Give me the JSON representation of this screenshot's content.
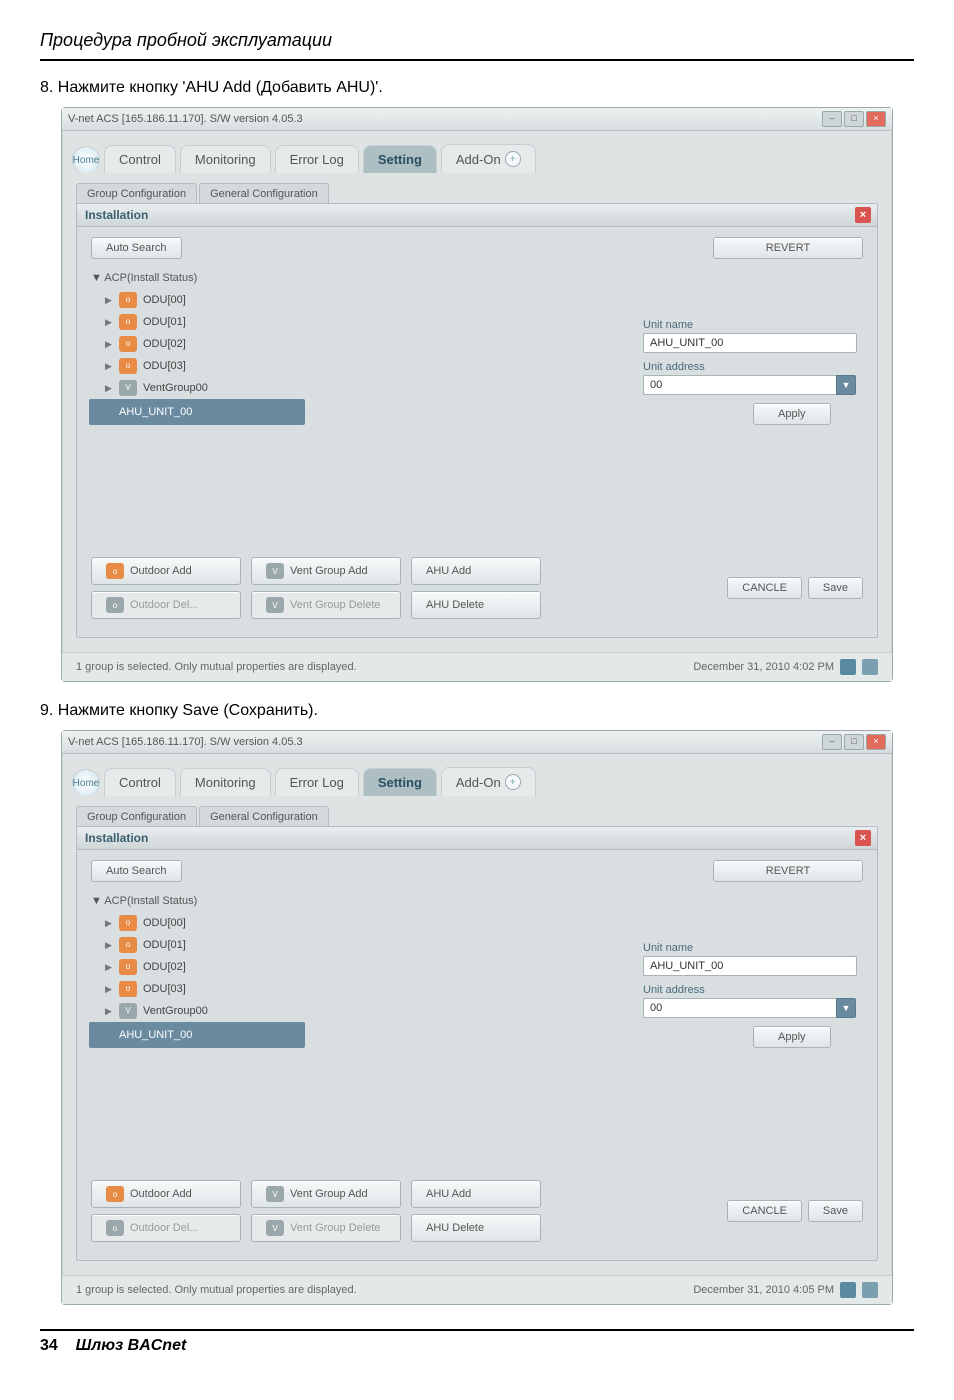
{
  "page": {
    "header": "Процедура пробной эксплуатации",
    "step8": "8. Нажмите кнопку 'AHU Add (Добавить AHU)'.",
    "step9": "9. Нажмите кнопку Save (Сохранить).",
    "footer_page": "34",
    "footer_text": "Шлюз BACnet"
  },
  "window": {
    "title": "V-net ACS [165.186.11.170].   S/W version 4.05.3",
    "tabs": {
      "home": "Home",
      "control": "Control",
      "monitoring": "Monitoring",
      "errorlog": "Error Log",
      "setting": "Setting",
      "addon": "Add-On"
    },
    "subtabs": {
      "group": "Group Configuration",
      "general": "General Configuration"
    },
    "panel": {
      "title": "Installation",
      "auto_search": "Auto Search",
      "tree_root": "▼ ACP(Install Status)",
      "tree": [
        {
          "label": "ODU[00]",
          "icon": "orange"
        },
        {
          "label": "ODU[01]",
          "icon": "orange"
        },
        {
          "label": "ODU[02]",
          "icon": "orange"
        },
        {
          "label": "ODU[03]",
          "icon": "orange"
        },
        {
          "label": "VentGroup00",
          "icon": "gray"
        }
      ],
      "selected": "AHU_UNIT_00",
      "revert": "REVERT",
      "unit_name_label": "Unit name",
      "unit_name_value": "AHU_UNIT_00",
      "unit_address_label": "Unit address",
      "unit_address_value": "00",
      "apply": "Apply",
      "buttons": {
        "outdoor_add": "Outdoor Add",
        "vent_group_add": "Vent Group Add",
        "ahu_add": "AHU Add",
        "outdoor_del": "Outdoor Del...",
        "vent_group_del": "Vent Group Delete",
        "ahu_delete": "AHU Delete",
        "cancle": "CANCLE",
        "save": "Save"
      }
    },
    "status": {
      "msg": "1 group is selected. Only mutual properties are displayed.",
      "time1": "December 31, 2010  4:02 PM",
      "time2": "December 31, 2010  4:05 PM"
    }
  }
}
